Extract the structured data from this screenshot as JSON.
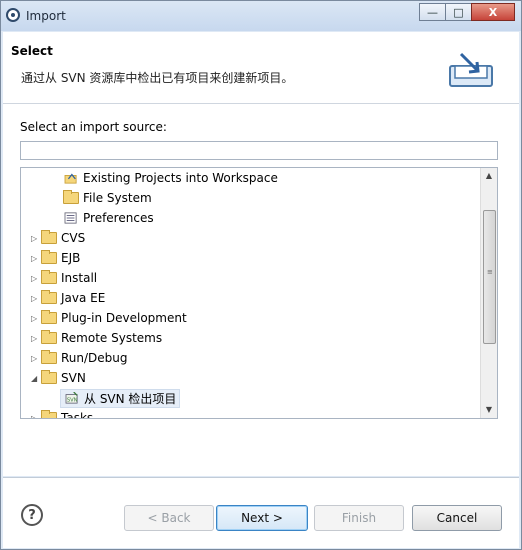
{
  "window": {
    "title": "Import"
  },
  "titlebar_buttons": {
    "minimize": "—",
    "maximize": "□",
    "close": "X"
  },
  "header": {
    "title": "Select",
    "description": "通过从 SVN 资源库中检出已有项目来创建新项目。"
  },
  "source": {
    "label": "Select an import source:",
    "filter_value": ""
  },
  "tree": {
    "items": [
      {
        "label": "Existing Projects into Workspace",
        "icon": "project-import-icon"
      },
      {
        "label": "File System",
        "icon": "folder-icon"
      },
      {
        "label": "Preferences",
        "icon": "preferences-icon"
      },
      {
        "label": "CVS",
        "icon": "folder-icon",
        "expanded": false
      },
      {
        "label": "EJB",
        "icon": "folder-icon",
        "expanded": false
      },
      {
        "label": "Install",
        "icon": "folder-icon",
        "expanded": false
      },
      {
        "label": "Java EE",
        "icon": "folder-icon",
        "expanded": false
      },
      {
        "label": "Plug-in Development",
        "icon": "folder-icon",
        "expanded": false
      },
      {
        "label": "Remote Systems",
        "icon": "folder-icon",
        "expanded": false
      },
      {
        "label": "Run/Debug",
        "icon": "folder-icon",
        "expanded": false
      },
      {
        "label": "SVN",
        "icon": "folder-icon",
        "expanded": true
      },
      {
        "label": "从 SVN 检出项目",
        "icon": "svn-checkout-icon",
        "selected": true
      },
      {
        "label": "Tasks",
        "icon": "folder-icon",
        "expanded": false
      }
    ]
  },
  "buttons": {
    "back": "< Back",
    "next": "Next >",
    "finish": "Finish",
    "cancel": "Cancel",
    "help": "?"
  },
  "colors": {
    "accent": "#3a84c5",
    "titlebar": "#c7d8ee",
    "close": "#c6443a"
  }
}
